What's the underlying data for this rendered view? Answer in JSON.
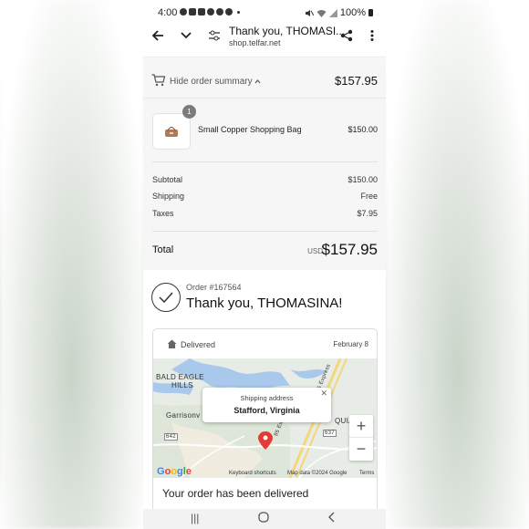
{
  "status_bar": {
    "time": "4:00",
    "battery": "100%"
  },
  "browser": {
    "title": "Thank you, THOMASI...",
    "url": "shop.telfar.net"
  },
  "summary": {
    "toggle_label": "Hide order summary",
    "total": "$157.95"
  },
  "item": {
    "quantity": "1",
    "name": "Small Copper Shopping Bag",
    "price": "$150.00"
  },
  "costs": {
    "subtotal_label": "Subtotal",
    "subtotal": "$150.00",
    "shipping_label": "Shipping",
    "shipping": "Free",
    "taxes_label": "Taxes",
    "taxes": "$7.95"
  },
  "grand_total": {
    "label": "Total",
    "currency": "USD",
    "amount": "$157.95"
  },
  "order": {
    "number": "Order #167564",
    "thanks": "Thank you, THOMASINA!"
  },
  "delivery": {
    "status": "Delivered",
    "date": "February 8",
    "title": "Your order has been delivered"
  },
  "map": {
    "labels": {
      "bald_eagle": "BALD EAGLE",
      "hills": "HILLS",
      "garrison": "Garrisonv",
      "aquia": "QUIA",
      "route_642": "642",
      "route_637": "637",
      "express": "95 Express Lanes",
      "express2": "95 Express"
    },
    "popup_title": "Shipping address",
    "popup_place": "Stafford, Virginia",
    "keyboard": "Keyboard shortcuts",
    "mapdata": "Map data ©2024 Google",
    "terms": "Terms",
    "google": "Google"
  },
  "colors": {
    "water": "#a9c9ec",
    "road": "#f3d77a",
    "pin": "#e53935"
  }
}
